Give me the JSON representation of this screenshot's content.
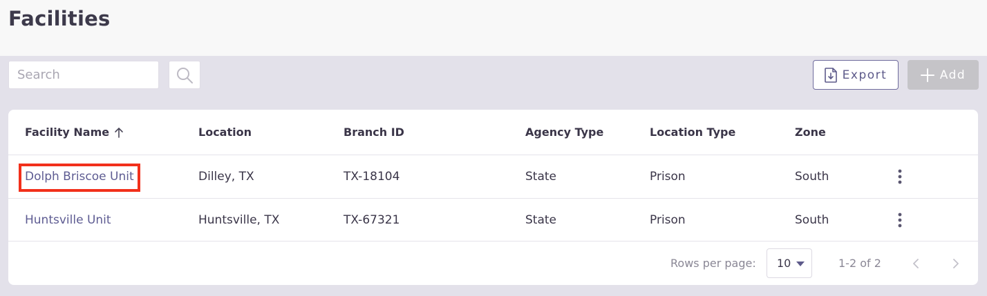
{
  "page": {
    "title": "Facilities"
  },
  "toolbar": {
    "search_placeholder": "Search",
    "search_icon": "search-icon",
    "export_label": "Export",
    "export_icon": "file-download-icon",
    "add_label": "Add",
    "add_icon": "plus-icon"
  },
  "table": {
    "columns": {
      "facility_name": "Facility Name",
      "location": "Location",
      "branch_id": "Branch ID",
      "agency_type": "Agency Type",
      "location_type": "Location Type",
      "zone": "Zone"
    },
    "sort": {
      "column": "Facility Name",
      "direction": "ascending",
      "icon": "arrow-up-icon"
    },
    "rows": [
      {
        "facility_name": "Dolph Briscoe Unit",
        "location": "Dilley, TX",
        "branch_id": "TX-18104",
        "agency_type": "State",
        "location_type": "Prison",
        "zone": "South",
        "highlighted": true
      },
      {
        "facility_name": "Huntsville Unit",
        "location": "Huntsville, TX",
        "branch_id": "TX-67321",
        "agency_type": "State",
        "location_type": "Prison",
        "zone": "South",
        "highlighted": false
      }
    ],
    "row_menu_icon": "more-vertical-icon"
  },
  "pagination": {
    "rows_per_page_label": "Rows per page:",
    "rows_per_page_value": "10",
    "range_text": "1-2 of 2",
    "prev_icon": "chevron-left-icon",
    "next_icon": "chevron-right-icon"
  },
  "colors": {
    "background": "#e3e1ea",
    "header_background": "#f8f8f8",
    "link": "#5e5c92",
    "export_border": "#6e6a9c",
    "add_disabled": "#c5c4c8",
    "highlight": "#f2301b"
  }
}
